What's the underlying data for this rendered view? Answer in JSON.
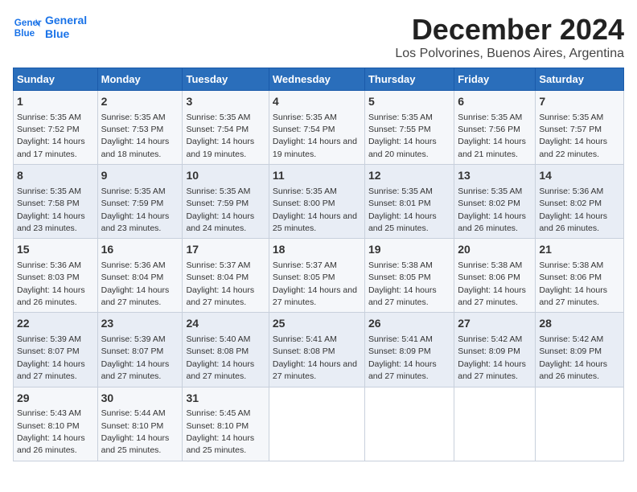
{
  "header": {
    "logo_line1": "General",
    "logo_line2": "Blue",
    "title": "December 2024",
    "subtitle": "Los Polvorines, Buenos Aires, Argentina"
  },
  "days_of_week": [
    "Sunday",
    "Monday",
    "Tuesday",
    "Wednesday",
    "Thursday",
    "Friday",
    "Saturday"
  ],
  "weeks": [
    [
      {
        "day": "1",
        "sunrise": "Sunrise: 5:35 AM",
        "sunset": "Sunset: 7:52 PM",
        "daylight": "Daylight: 14 hours and 17 minutes."
      },
      {
        "day": "2",
        "sunrise": "Sunrise: 5:35 AM",
        "sunset": "Sunset: 7:53 PM",
        "daylight": "Daylight: 14 hours and 18 minutes."
      },
      {
        "day": "3",
        "sunrise": "Sunrise: 5:35 AM",
        "sunset": "Sunset: 7:54 PM",
        "daylight": "Daylight: 14 hours and 19 minutes."
      },
      {
        "day": "4",
        "sunrise": "Sunrise: 5:35 AM",
        "sunset": "Sunset: 7:54 PM",
        "daylight": "Daylight: 14 hours and 19 minutes."
      },
      {
        "day": "5",
        "sunrise": "Sunrise: 5:35 AM",
        "sunset": "Sunset: 7:55 PM",
        "daylight": "Daylight: 14 hours and 20 minutes."
      },
      {
        "day": "6",
        "sunrise": "Sunrise: 5:35 AM",
        "sunset": "Sunset: 7:56 PM",
        "daylight": "Daylight: 14 hours and 21 minutes."
      },
      {
        "day": "7",
        "sunrise": "Sunrise: 5:35 AM",
        "sunset": "Sunset: 7:57 PM",
        "daylight": "Daylight: 14 hours and 22 minutes."
      }
    ],
    [
      {
        "day": "8",
        "sunrise": "Sunrise: 5:35 AM",
        "sunset": "Sunset: 7:58 PM",
        "daylight": "Daylight: 14 hours and 23 minutes."
      },
      {
        "day": "9",
        "sunrise": "Sunrise: 5:35 AM",
        "sunset": "Sunset: 7:59 PM",
        "daylight": "Daylight: 14 hours and 23 minutes."
      },
      {
        "day": "10",
        "sunrise": "Sunrise: 5:35 AM",
        "sunset": "Sunset: 7:59 PM",
        "daylight": "Daylight: 14 hours and 24 minutes."
      },
      {
        "day": "11",
        "sunrise": "Sunrise: 5:35 AM",
        "sunset": "Sunset: 8:00 PM",
        "daylight": "Daylight: 14 hours and 25 minutes."
      },
      {
        "day": "12",
        "sunrise": "Sunrise: 5:35 AM",
        "sunset": "Sunset: 8:01 PM",
        "daylight": "Daylight: 14 hours and 25 minutes."
      },
      {
        "day": "13",
        "sunrise": "Sunrise: 5:35 AM",
        "sunset": "Sunset: 8:02 PM",
        "daylight": "Daylight: 14 hours and 26 minutes."
      },
      {
        "day": "14",
        "sunrise": "Sunrise: 5:36 AM",
        "sunset": "Sunset: 8:02 PM",
        "daylight": "Daylight: 14 hours and 26 minutes."
      }
    ],
    [
      {
        "day": "15",
        "sunrise": "Sunrise: 5:36 AM",
        "sunset": "Sunset: 8:03 PM",
        "daylight": "Daylight: 14 hours and 26 minutes."
      },
      {
        "day": "16",
        "sunrise": "Sunrise: 5:36 AM",
        "sunset": "Sunset: 8:04 PM",
        "daylight": "Daylight: 14 hours and 27 minutes."
      },
      {
        "day": "17",
        "sunrise": "Sunrise: 5:37 AM",
        "sunset": "Sunset: 8:04 PM",
        "daylight": "Daylight: 14 hours and 27 minutes."
      },
      {
        "day": "18",
        "sunrise": "Sunrise: 5:37 AM",
        "sunset": "Sunset: 8:05 PM",
        "daylight": "Daylight: 14 hours and 27 minutes."
      },
      {
        "day": "19",
        "sunrise": "Sunrise: 5:38 AM",
        "sunset": "Sunset: 8:05 PM",
        "daylight": "Daylight: 14 hours and 27 minutes."
      },
      {
        "day": "20",
        "sunrise": "Sunrise: 5:38 AM",
        "sunset": "Sunset: 8:06 PM",
        "daylight": "Daylight: 14 hours and 27 minutes."
      },
      {
        "day": "21",
        "sunrise": "Sunrise: 5:38 AM",
        "sunset": "Sunset: 8:06 PM",
        "daylight": "Daylight: 14 hours and 27 minutes."
      }
    ],
    [
      {
        "day": "22",
        "sunrise": "Sunrise: 5:39 AM",
        "sunset": "Sunset: 8:07 PM",
        "daylight": "Daylight: 14 hours and 27 minutes."
      },
      {
        "day": "23",
        "sunrise": "Sunrise: 5:39 AM",
        "sunset": "Sunset: 8:07 PM",
        "daylight": "Daylight: 14 hours and 27 minutes."
      },
      {
        "day": "24",
        "sunrise": "Sunrise: 5:40 AM",
        "sunset": "Sunset: 8:08 PM",
        "daylight": "Daylight: 14 hours and 27 minutes."
      },
      {
        "day": "25",
        "sunrise": "Sunrise: 5:41 AM",
        "sunset": "Sunset: 8:08 PM",
        "daylight": "Daylight: 14 hours and 27 minutes."
      },
      {
        "day": "26",
        "sunrise": "Sunrise: 5:41 AM",
        "sunset": "Sunset: 8:09 PM",
        "daylight": "Daylight: 14 hours and 27 minutes."
      },
      {
        "day": "27",
        "sunrise": "Sunrise: 5:42 AM",
        "sunset": "Sunset: 8:09 PM",
        "daylight": "Daylight: 14 hours and 27 minutes."
      },
      {
        "day": "28",
        "sunrise": "Sunrise: 5:42 AM",
        "sunset": "Sunset: 8:09 PM",
        "daylight": "Daylight: 14 hours and 26 minutes."
      }
    ],
    [
      {
        "day": "29",
        "sunrise": "Sunrise: 5:43 AM",
        "sunset": "Sunset: 8:10 PM",
        "daylight": "Daylight: 14 hours and 26 minutes."
      },
      {
        "day": "30",
        "sunrise": "Sunrise: 5:44 AM",
        "sunset": "Sunset: 8:10 PM",
        "daylight": "Daylight: 14 hours and 25 minutes."
      },
      {
        "day": "31",
        "sunrise": "Sunrise: 5:45 AM",
        "sunset": "Sunset: 8:10 PM",
        "daylight": "Daylight: 14 hours and 25 minutes."
      },
      null,
      null,
      null,
      null
    ]
  ]
}
